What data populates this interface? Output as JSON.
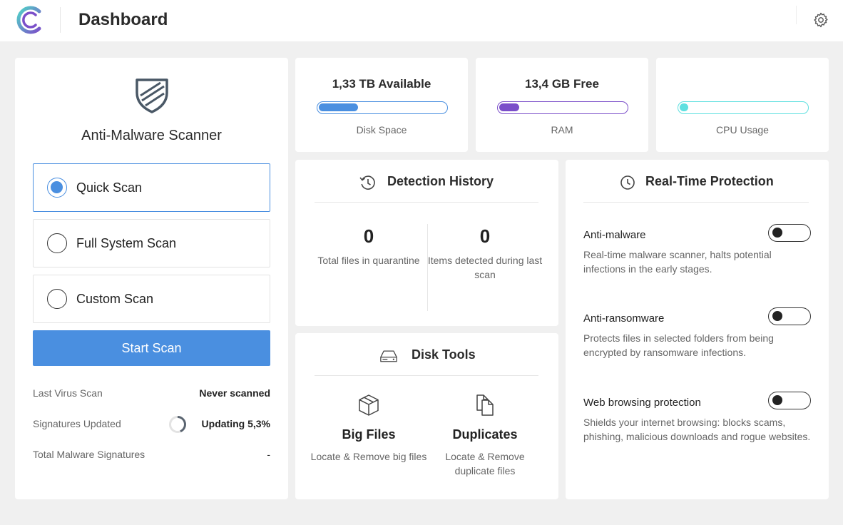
{
  "header": {
    "title": "Dashboard"
  },
  "scanner": {
    "title": "Anti-Malware Scanner",
    "options": [
      {
        "label": "Quick Scan",
        "selected": true
      },
      {
        "label": "Full System Scan",
        "selected": false
      },
      {
        "label": "Custom Scan",
        "selected": false
      }
    ],
    "start_label": "Start Scan",
    "info": [
      {
        "label": "Last Virus Scan",
        "value": "Never scanned"
      },
      {
        "label": "Signatures Updated",
        "value": "Updating 5,3%"
      },
      {
        "label": "Total Malware Signatures",
        "value": "-"
      }
    ]
  },
  "stats": {
    "disk": {
      "value": "1,33 TB Available",
      "label": "Disk Space",
      "level": 0.31,
      "color": "#4a8fe0"
    },
    "ram": {
      "value": "13,4 GB Free",
      "label": "RAM",
      "level": 0.16,
      "color": "#7b4fc9"
    },
    "cpu": {
      "value": "",
      "label": "CPU Usage",
      "level": 0.07,
      "color": "#5fe0e0"
    }
  },
  "history": {
    "title": "Detection History",
    "quarantine_count": "0",
    "quarantine_label": "Total files in quarantine",
    "detected_count": "0",
    "detected_label": "Items detected during last scan"
  },
  "disk_tools": {
    "title": "Disk Tools",
    "big_files": {
      "title": "Big Files",
      "desc": "Locate & Remove big files"
    },
    "duplicates": {
      "title": "Duplicates",
      "desc": "Locate & Remove duplicate files"
    }
  },
  "realtime": {
    "title": "Real-Time Protection",
    "items": [
      {
        "title": "Anti-malware",
        "desc": "Real-time malware scanner, halts potential infections in the early stages.",
        "enabled": false
      },
      {
        "title": "Anti-ransomware",
        "desc": "Protects files in selected folders from being encrypted by ransomware infections.",
        "enabled": false
      },
      {
        "title": "Web browsing protection",
        "desc": "Shields your internet browsing: blocks scams, phishing, malicious downloads and rogue websites.",
        "enabled": false
      }
    ]
  },
  "icons": {
    "logo": "app-logo-icon",
    "settings": "gear-icon",
    "scanner": "shield-icon",
    "history": "history-clock-icon",
    "disk": "hard-drive-icon",
    "big_files": "box-icon",
    "duplicates": "duplicate-files-icon",
    "realtime": "clock-icon"
  }
}
